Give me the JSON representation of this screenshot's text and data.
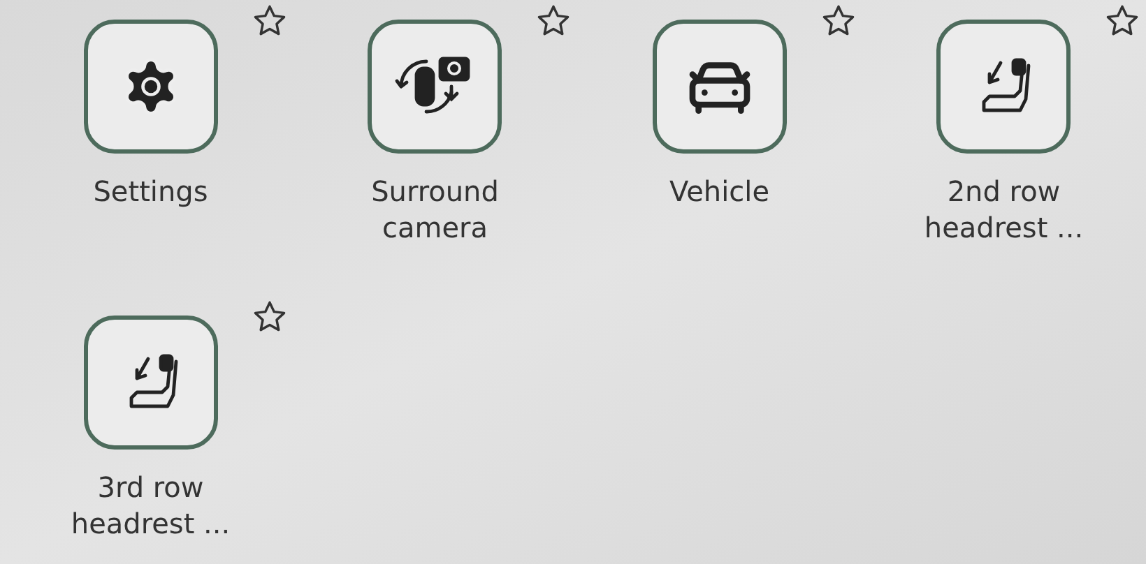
{
  "tiles": [
    {
      "kind": "settings",
      "label": "Settings",
      "starred": false
    },
    {
      "kind": "camera",
      "label": "Surround camera",
      "starred": false
    },
    {
      "kind": "vehicle",
      "label": "Vehicle",
      "starred": false
    },
    {
      "kind": "headrest",
      "label": "2nd row headrest ...",
      "starred": false
    },
    {
      "kind": "headrest",
      "label": "3rd row headrest ...",
      "starred": false
    }
  ]
}
